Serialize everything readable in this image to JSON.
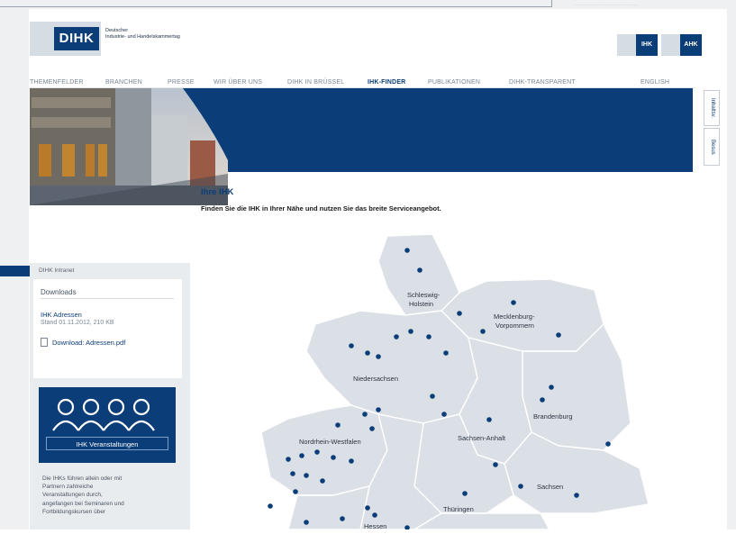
{
  "header": {
    "logo_text": "DIHK",
    "logo_subtitle_line1": "Deutscher",
    "logo_subtitle_line2": "Industrie- und Handelskammertag",
    "lang_buttons": [
      "IHK",
      "AHK"
    ],
    "topright_text": "…………………… ……………… ………"
  },
  "nav": {
    "items": [
      "THEMENFELDER",
      "BRANCHEN",
      "PRESSE",
      "WIR ÜBER UNS",
      "DIHK IN BRÜSSEL",
      "IHK-FINDER",
      "PUBLIKATIONEN",
      "DIHK-TRANSPARENT",
      "ENGLISH"
    ],
    "active": "IHK-FINDER"
  },
  "side_tabs": [
    "Inhaltsv.",
    "Besus"
  ],
  "sidebar": {
    "section_label": "DIHK Intranet",
    "downloads_title": "Downloads",
    "file_title": "IHK Adressen",
    "file_meta": "Stand 01.11.2012, 210 KB",
    "file_link": "Download: Adressen.pdf",
    "event_label": "IHK Veranstaltungen",
    "event_text": [
      "Die IHKs führen allein oder mit",
      "Partnern zahlreiche",
      "Veranstaltungen durch,",
      "angefangen bei Seminaren und",
      "Fortbildungskursen über"
    ]
  },
  "main": {
    "title": "Ihre IHK",
    "subtitle": "Finden Sie die IHK in Ihrer Nähe und nutzen Sie das breite Serviceangebot."
  },
  "map": {
    "states": [
      "Schleswig-Holstein",
      "Mecklenburg-Vorpommern",
      "Niedersachsen",
      "Brandenburg",
      "Nordrhein-Westfalen",
      "Sachsen-Anhalt",
      "Sachsen",
      "Thüringen",
      "Hessen"
    ],
    "colors": {
      "land": "#dbe0e6",
      "border": "#ffffff",
      "dot": "#0b3d78"
    }
  },
  "colors": {
    "brand_blue": "#0b3d78",
    "light_grey": "#d6dce4"
  }
}
